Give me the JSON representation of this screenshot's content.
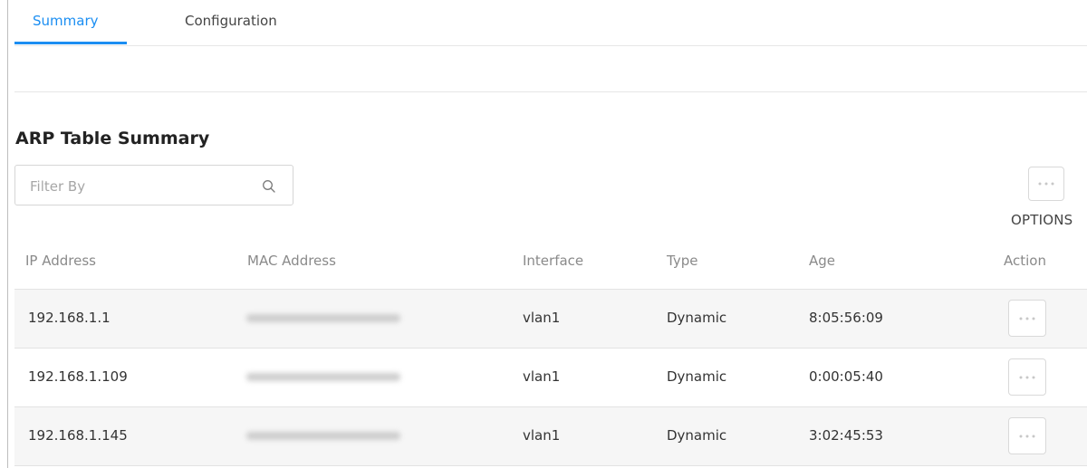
{
  "tabs": [
    {
      "label": "Summary",
      "active": true
    },
    {
      "label": "Configuration",
      "active": false
    }
  ],
  "section_title": "ARP Table Summary",
  "filter": {
    "placeholder": "Filter By",
    "value": ""
  },
  "options": {
    "label": "OPTIONS"
  },
  "table": {
    "columns": [
      "IP Address",
      "MAC Address",
      "Interface",
      "Type",
      "Age",
      "Action"
    ],
    "rows": [
      {
        "ip": "192.168.1.1",
        "mac": "",
        "interface": "vlan1",
        "type": "Dynamic",
        "age": "8:05:56:09"
      },
      {
        "ip": "192.168.1.109",
        "mac": "",
        "interface": "vlan1",
        "type": "Dynamic",
        "age": "0:00:05:40"
      },
      {
        "ip": "192.168.1.145",
        "mac": "",
        "interface": "vlan1",
        "type": "Dynamic",
        "age": "3:02:45:53"
      }
    ]
  },
  "colors": {
    "accent": "#1b8ef2",
    "row_shade": "#f6f6f6",
    "border": "#e3e3e3"
  },
  "icons": {
    "search": "search-icon",
    "more": "more-horizontal-icon"
  }
}
